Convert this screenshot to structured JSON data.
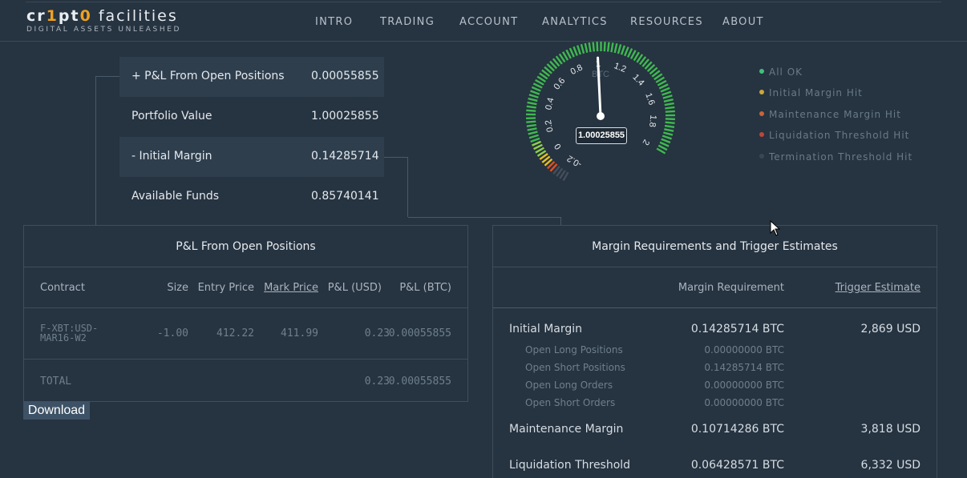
{
  "brand": {
    "logo_prefix": "cr",
    "logo_one": "1",
    "logo_mid": "pt",
    "logo_zero": "0",
    "logo_suffix": " facilities",
    "tagline": "DIGITAL ASSETS UNLEASHED"
  },
  "nav": [
    "INTRO",
    "TRADING",
    "ACCOUNT",
    "ANALYTICS",
    "RESOURCES",
    "ABOUT"
  ],
  "summary": [
    {
      "label": "+ P&L From Open Positions",
      "value": "0.00055855"
    },
    {
      "label": "Portfolio Value",
      "value": "1.00025855"
    },
    {
      "label": "- Initial Margin",
      "value": "0.14285714"
    },
    {
      "label": "Available Funds",
      "value": "0.85740141"
    }
  ],
  "gauge": {
    "unit": "BTC",
    "readout": "1.00025855",
    "value": 1.00025855,
    "min": -0.2,
    "max": 2,
    "ticks": [
      "-0.2",
      "0",
      "0.2",
      "0.4",
      "0.6",
      "0.8",
      "1",
      "1.2",
      "1.4",
      "1.6",
      "1.8",
      "2"
    ],
    "colors": {
      "ok": "#3fb950",
      "warn": "#e8c020",
      "danger": "#e05020"
    }
  },
  "legend": [
    {
      "label": "All OK",
      "color": "#3ec27a"
    },
    {
      "label": "Initial Margin Hit",
      "color": "#c8a83a"
    },
    {
      "label": "Maintenance Margin Hit",
      "color": "#c8643a"
    },
    {
      "label": "Liquidation Threshold Hit",
      "color": "#c0443a"
    },
    {
      "label": "Termination Threshold Hit",
      "color": "#3a4653"
    }
  ],
  "pnl": {
    "title": "P&L From Open Positions",
    "columns": [
      "Contract",
      "Size",
      "Entry Price",
      "Mark Price",
      "P&L (USD)",
      "P&L (BTC)"
    ],
    "rows": [
      {
        "contract_line1": "F-XBT:USD-",
        "contract_line2": "MAR16-W2",
        "size": "-1.00",
        "entry": "412.22",
        "mark": "411.99",
        "pnl_usd": "0.23",
        "pnl_btc": "0.00055855"
      }
    ],
    "total": {
      "label": "TOTAL",
      "pnl_usd": "0.23",
      "pnl_btc": "0.00055855"
    },
    "download_label": "Download"
  },
  "margin": {
    "title": "Margin Requirements and Trigger Estimates",
    "col_requirement": "Margin Requirement",
    "col_trigger": "Trigger Estimate",
    "initial": {
      "label": "Initial Margin",
      "requirement": "0.14285714 BTC",
      "trigger": "2,869 USD"
    },
    "breakdown": [
      {
        "label": "Open Long Positions",
        "value": "0.00000000 BTC"
      },
      {
        "label": "Open Short Positions",
        "value": "0.14285714 BTC"
      },
      {
        "label": "Open Long Orders",
        "value": "0.00000000 BTC"
      },
      {
        "label": "Open Short Orders",
        "value": "0.00000000 BTC"
      }
    ],
    "maintenance": {
      "label": "Maintenance Margin",
      "requirement": "0.10714286 BTC",
      "trigger": "3,818 USD"
    },
    "liquidation": {
      "label": "Liquidation Threshold",
      "requirement": "0.06428571 BTC",
      "trigger": "6,332 USD"
    }
  }
}
